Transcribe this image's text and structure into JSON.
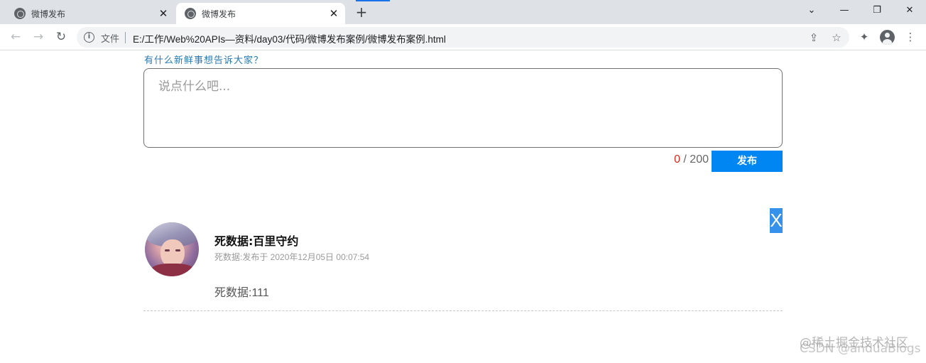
{
  "browser": {
    "tabs": [
      {
        "title": "微博发布",
        "active": false,
        "close_glyph": "✕"
      },
      {
        "title": "微博发布",
        "active": true,
        "close_glyph": "✕"
      }
    ],
    "new_tab_glyph": "+",
    "window_controls": {
      "dropdown": "⌄",
      "minimize": "—",
      "restore": "❐",
      "close": "✕"
    },
    "nav": {
      "back": "←",
      "forward": "→",
      "reload": "↻"
    },
    "address": {
      "info_glyph": "i",
      "scheme_label": "文件",
      "url": "E:/工作/Web%20APIs—资料/day03/代码/微博发布案例/微博发布案例.html",
      "share_glyph": "⇪",
      "star_glyph": "☆"
    },
    "toolbar_icons": {
      "extensions": "✦",
      "menu": "⋮"
    },
    "accent_color": "#1a73e8"
  },
  "composer": {
    "prompt": "有什么新鲜事想告诉大家？",
    "placeholder": "说点什么吧...",
    "count_current": "0",
    "count_sep_max": " / 200",
    "publish_label": "发布",
    "publish_color": "#0086f3"
  },
  "post": {
    "delete_label": "X",
    "author": "死数据:百里守约",
    "time": "死数据:发布于 2020年12月05日 00:07:54",
    "content": "死数据:111"
  },
  "watermark": {
    "line1": "@稀土掘金技术社区",
    "line2": "CSDN @anduaBlogs"
  }
}
